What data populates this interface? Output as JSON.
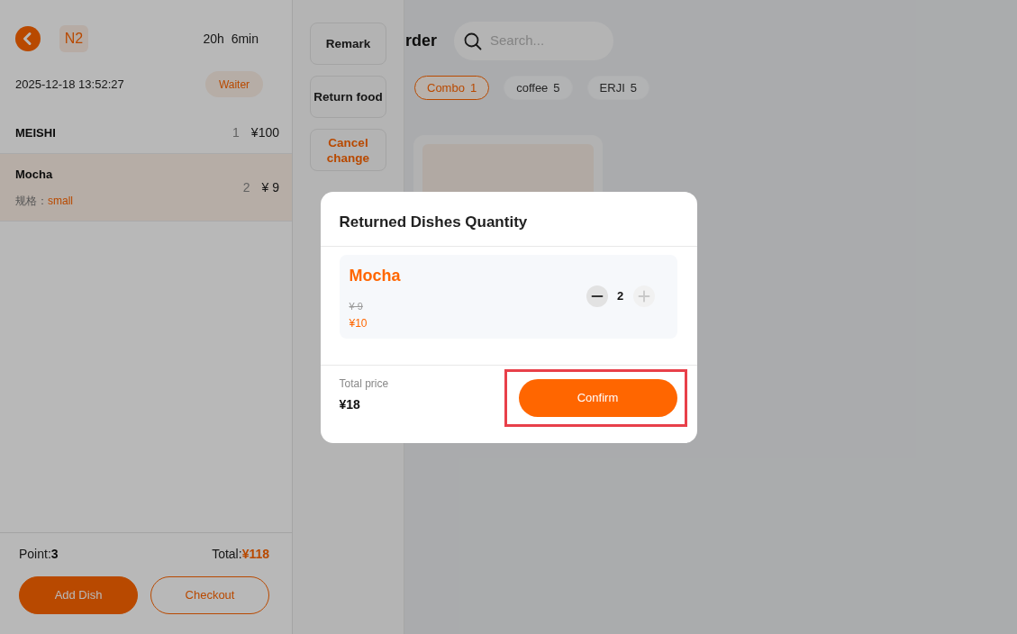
{
  "order_panel": {
    "table_badge": "N2",
    "duration": "20h 6min",
    "created_at": "2025-12-18 13:52:27",
    "staff_tag": "Waiter",
    "items": [
      {
        "name": "MEISHI",
        "quantity": "1",
        "price": "¥100",
        "selected": false
      },
      {
        "name": "Mocha",
        "spec_label": "规格：",
        "spec_value": "small",
        "quantity": "2",
        "price": "¥ 9",
        "selected": true
      }
    ],
    "points": {
      "label": "Point:",
      "value": "3"
    },
    "total": {
      "label": "Total:",
      "value": "¥118"
    },
    "buttons": [
      {
        "label": "Add Dish",
        "kind": "primary"
      },
      {
        "label": "Checkout",
        "kind": "outline"
      }
    ]
  },
  "actions": [
    {
      "label": "Remark",
      "kind": "default"
    },
    {
      "label": "Return food",
      "kind": "default"
    },
    {
      "label": "Cancel change",
      "kind": "warning"
    }
  ],
  "menu": {
    "title": "rder",
    "search": {
      "placeholder": "Search..."
    },
    "categories": [
      {
        "name": "Combo",
        "count": "1",
        "selected": true
      },
      {
        "name": "coffee",
        "count": "5",
        "selected": false
      },
      {
        "name": "ERJI",
        "count": "5",
        "selected": false
      }
    ]
  },
  "dialog": {
    "title": "Returned Dishes Quantity",
    "item": {
      "name": "Mocha",
      "original_price": "¥ 9",
      "price": "¥10",
      "quantity": "2",
      "minus_disabled": false,
      "plus_disabled": true
    },
    "total_label": "Total price",
    "total_value": "¥18",
    "confirm": "Confirm",
    "confirm_highlighted": true
  }
}
